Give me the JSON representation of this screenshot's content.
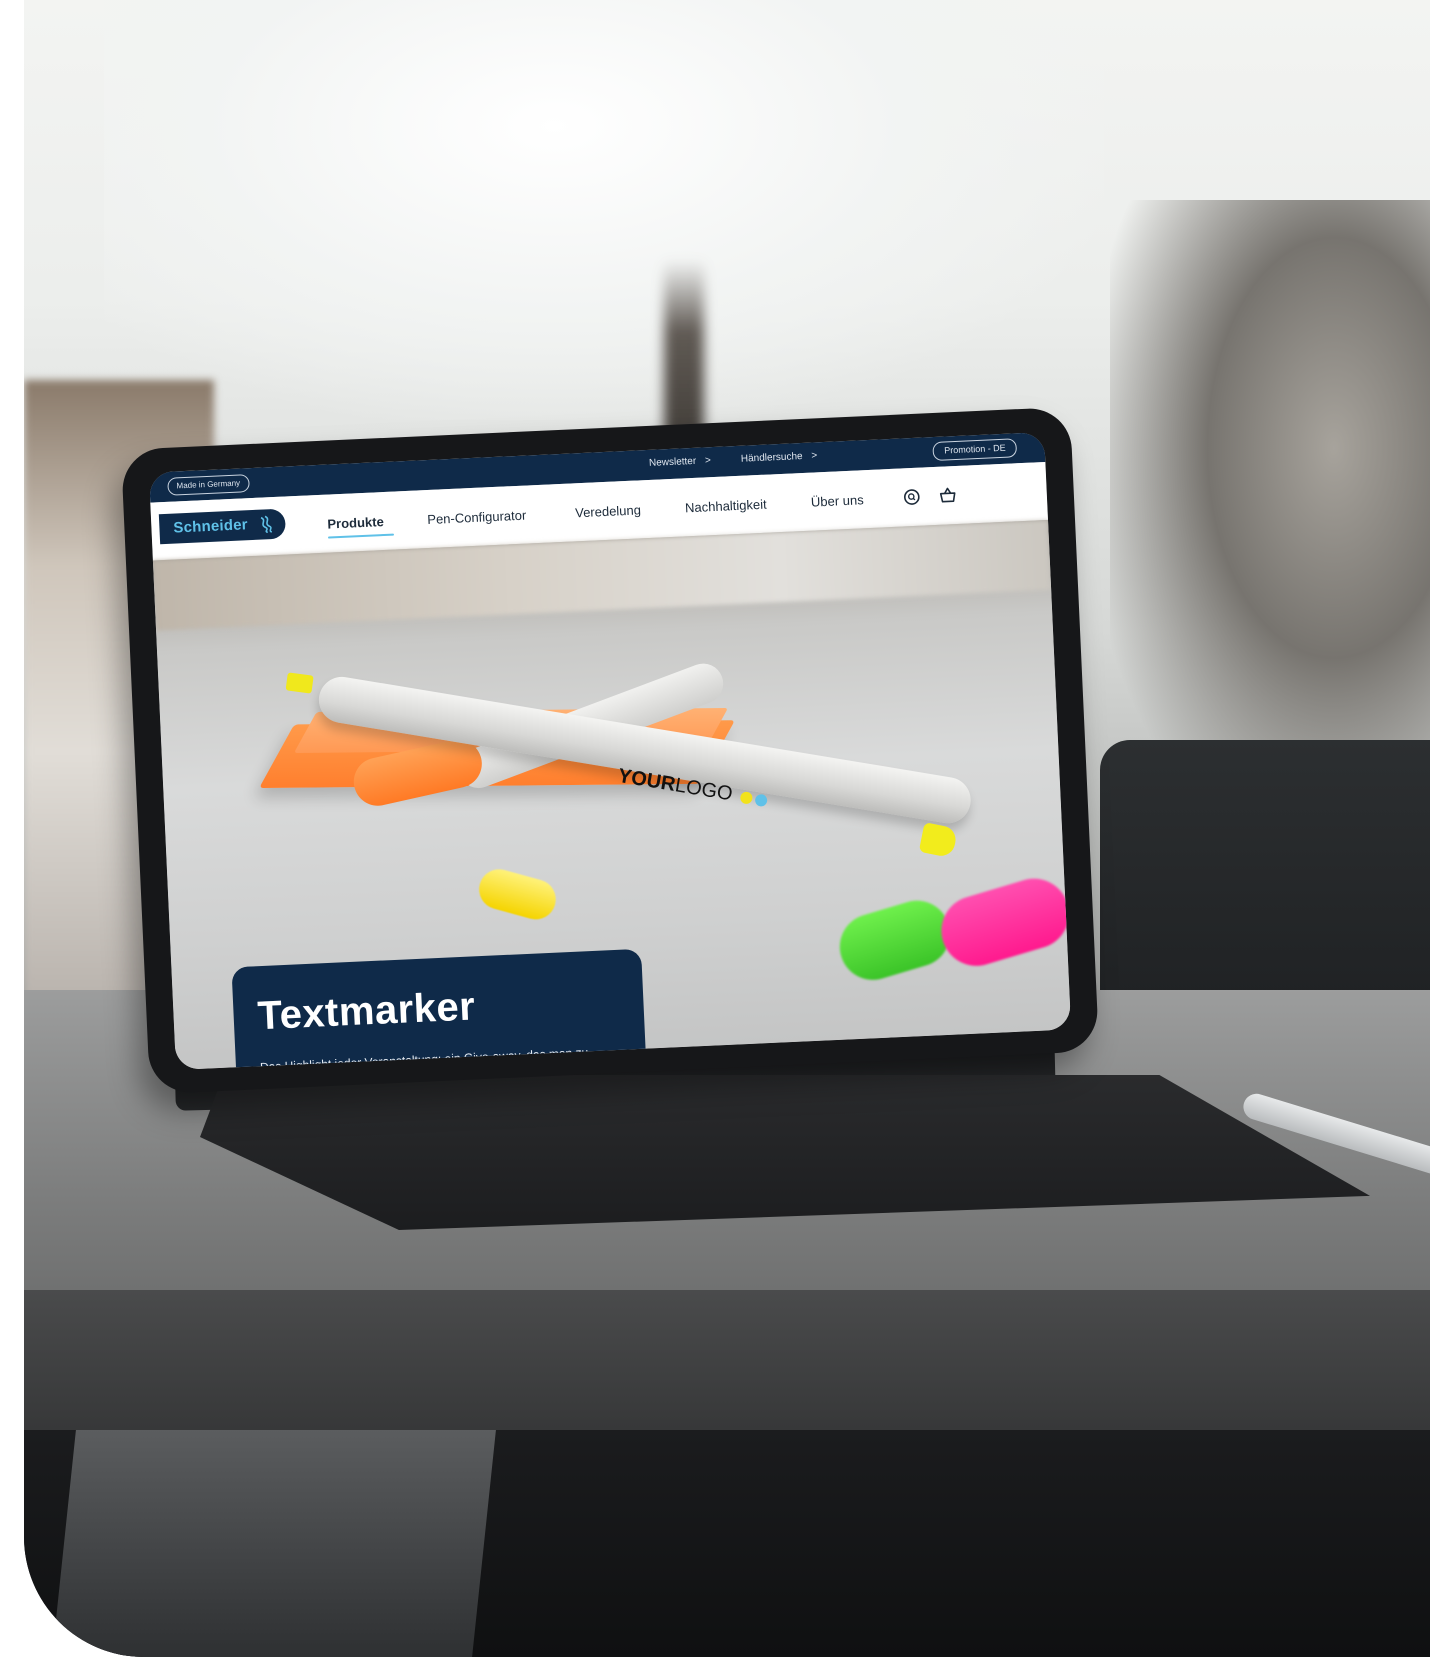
{
  "topbar": {
    "made_in": "Made in Germany",
    "newsletter": "Newsletter",
    "dealer": "Händlersuche",
    "chevron": ">",
    "promotion": "Promotion - DE"
  },
  "brand": {
    "name": "Schneider",
    "color": "#5fc1e8",
    "navy": "#0f2a49"
  },
  "nav": {
    "items": [
      {
        "label": "Produkte",
        "active": true
      },
      {
        "label": "Pen-Configurator"
      },
      {
        "label": "Veredelung"
      },
      {
        "label": "Nachhaltigkeit"
      },
      {
        "label": "Über uns"
      }
    ],
    "icons": [
      "search-icon",
      "cart-icon"
    ]
  },
  "hero": {
    "product_print_bold": "YOUR",
    "product_print_light": "LOGO",
    "title": "Textmarker",
    "subtitle": "Das Highlight jeder Veranstaltung: ein Give-away, das man zu Hause gern wieder in die Hand nimmt."
  }
}
